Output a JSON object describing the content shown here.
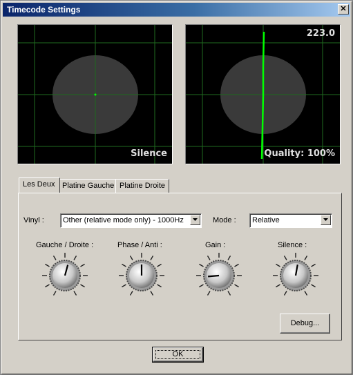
{
  "window": {
    "title": "Timecode Settings",
    "close_glyph": "✕"
  },
  "scopes": {
    "left": {
      "label": "Silence",
      "trace_color": "#00ff00"
    },
    "right": {
      "label": "Quality: 100%",
      "value": "223.0",
      "trace_color": "#00ff00"
    }
  },
  "tabs": [
    {
      "label": "Les Deux",
      "active": true
    },
    {
      "label": "Platine Gauche",
      "active": false
    },
    {
      "label": "Platine Droite",
      "active": false
    }
  ],
  "vinyl": {
    "label": "Vinyl :",
    "value": "Other (relative mode only) - 1000Hz"
  },
  "mode": {
    "label": "Mode :",
    "value": "Relative"
  },
  "knobs": [
    {
      "label": "Gauche / Droite :",
      "angle_deg": 15
    },
    {
      "label": "Phase / Anti :",
      "angle_deg": 0
    },
    {
      "label": "Gain :",
      "angle_deg": -95
    },
    {
      "label": "Silence :",
      "angle_deg": 10
    }
  ],
  "buttons": {
    "debug": "Debug...",
    "ok": "OK"
  },
  "icons": {
    "dropdown": "chevron-down-icon",
    "close": "close-icon"
  }
}
